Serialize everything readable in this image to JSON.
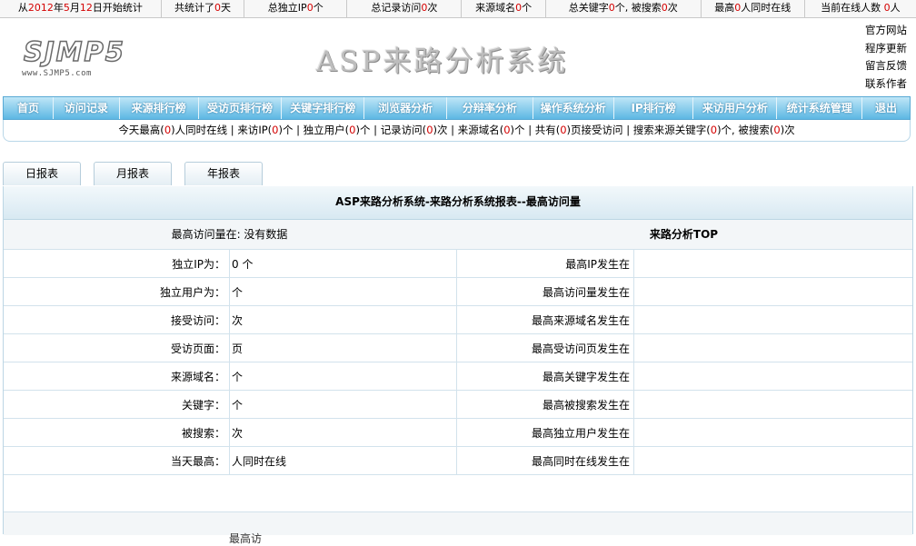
{
  "stats_bar": {
    "start": {
      "prefix": "从",
      "year": "2012",
      "year_unit": "年",
      "month": "5",
      "month_unit": "月",
      "day": "12",
      "suffix": "日开始统计"
    },
    "total_days": {
      "prefix": "共统计了",
      "value": "0",
      "suffix": "天"
    },
    "unique_ip": {
      "prefix": "总独立IP",
      "value": "0",
      "suffix": "个"
    },
    "total_visits": {
      "prefix": "总记录访问",
      "value": "0",
      "suffix": "次"
    },
    "referrer_domains": {
      "prefix": "来源域名",
      "value": "0",
      "suffix": "个"
    },
    "keywords": {
      "prefix": "总关键字",
      "value": "0",
      "mid": "个, 被搜索",
      "value2": "0",
      "suffix": "次"
    },
    "peak_online": {
      "prefix": "最高",
      "value": "0",
      "suffix": "人同时在线"
    },
    "current_online": {
      "prefix": "当前在线人数 ",
      "value": "0",
      "suffix": "人"
    }
  },
  "header": {
    "logo_big": "SJMP5",
    "logo_small": "www.SJMP5.com",
    "title": "ASP来路分析系统",
    "links": [
      "官方网站",
      "程序更新",
      "留言反馈",
      "联系作者"
    ]
  },
  "nav": [
    "首页",
    "访问记录",
    "来源排行榜",
    "受访页排行榜",
    "关键字排行榜",
    "浏览器分析",
    "分辩率分析",
    "操作系统分析",
    "IP排行榜",
    "来访用户分析",
    "统计系统管理",
    "退出"
  ],
  "today": {
    "peak": {
      "prefix": "今天最高(",
      "value": "0",
      "suffix": ")人同时在线"
    },
    "ip": {
      "prefix": "来访IP(",
      "value": "0",
      "suffix": ")个"
    },
    "users": {
      "prefix": "独立用户(",
      "value": "0",
      "suffix": ")个"
    },
    "visits": {
      "prefix": "记录访问(",
      "value": "0",
      "suffix": ")次"
    },
    "domains": {
      "prefix": "来源域名(",
      "value": "0",
      "suffix": ")个"
    },
    "pages": {
      "prefix": "共有(",
      "value": "0",
      "suffix": ")页接受访问"
    },
    "search": {
      "prefix": "搜索来源关键字(",
      "value": "0",
      "mid": ")个, 被搜索(",
      "value2": "0",
      "suffix": ")次"
    },
    "sep": "|"
  },
  "report_tabs": [
    "日报表",
    "月报表",
    "年报表"
  ],
  "panel": {
    "title": "ASP来路分析系统-来路分析系统报表--最高访问量",
    "peak_label": "最高访问量在: 没有数据",
    "top_label": "来路分析TOP",
    "rows": [
      {
        "label1": "独立IP为：",
        "value1": "0 个",
        "label2": "最高IP发生在",
        "value2": ""
      },
      {
        "label1": "独立用户为：",
        "value1": "个",
        "label2": "最高访问量发生在",
        "value2": ""
      },
      {
        "label1": "接受访问：",
        "value1": "次",
        "label2": "最高来源域名发生在",
        "value2": ""
      },
      {
        "label1": "受访页面：",
        "value1": "页",
        "label2": "最高受访问页发生在",
        "value2": ""
      },
      {
        "label1": "来源域名：",
        "value1": "个",
        "label2": "最高关键字发生在",
        "value2": ""
      },
      {
        "label1": "关键字：",
        "value1": "个",
        "label2": "最高被搜索发生在",
        "value2": ""
      },
      {
        "label1": "被搜索：",
        "value1": "次",
        "label2": "最高独立用户发生在",
        "value2": ""
      },
      {
        "label1": "当天最高：",
        "value1": "人同时在线",
        "label2": "最高同时在线发生在",
        "value2": ""
      }
    ],
    "footer_text": "最高访"
  },
  "colors": {
    "accent_red": "#d40000",
    "nav_top": "#bfe6f7",
    "nav_bottom": "#5db7e3",
    "border": "#bcd6e4"
  }
}
